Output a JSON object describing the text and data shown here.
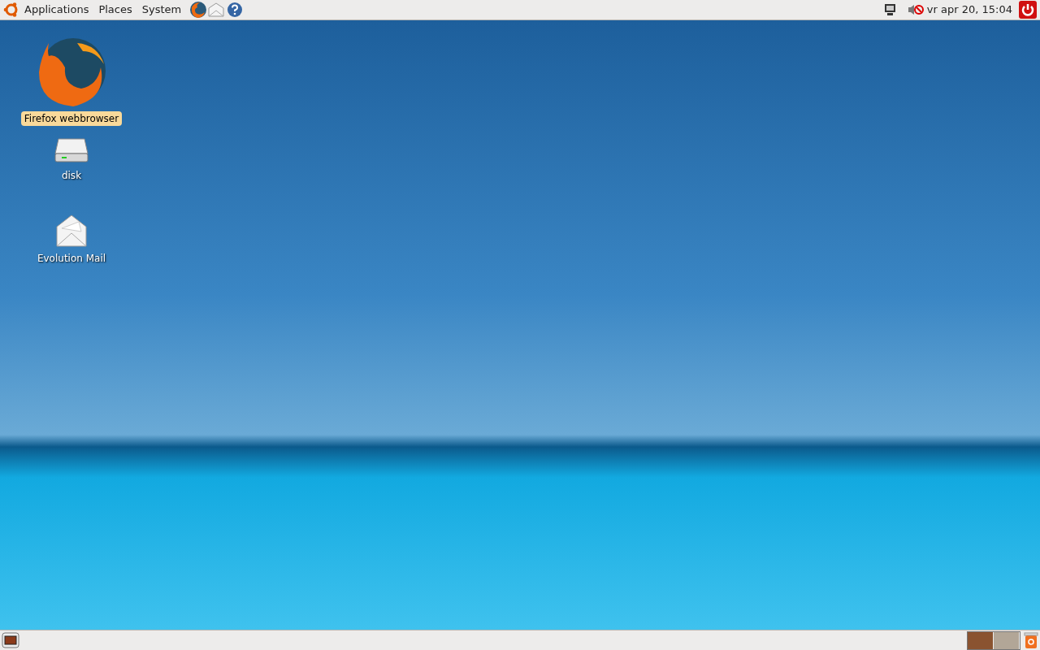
{
  "top_panel": {
    "menus": [
      "Applications",
      "Places",
      "System"
    ],
    "clock": "vr apr 20, 15:04"
  },
  "desktop_icons": [
    {
      "kind": "firefox",
      "label": "Firefox webbrowser",
      "selected": true
    },
    {
      "kind": "disk",
      "label": "disk",
      "selected": false
    },
    {
      "kind": "mail",
      "label": "Evolution Mail",
      "selected": false
    }
  ],
  "bottom_panel": {
    "workspaces": [
      {
        "selected": true
      },
      {
        "selected": false
      }
    ]
  }
}
